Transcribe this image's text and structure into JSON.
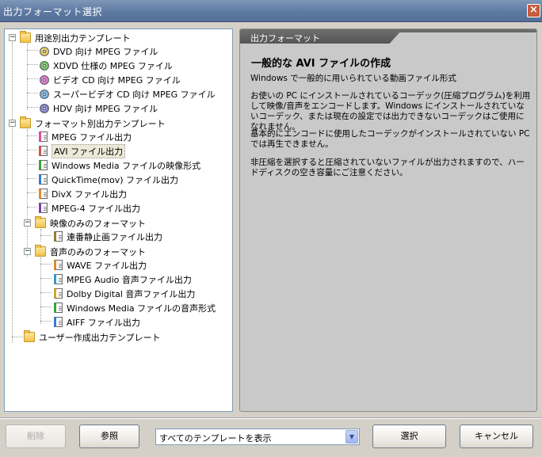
{
  "window": {
    "title": "出力フォーマット選択"
  },
  "tree": {
    "nodes": [
      {
        "label": "用途別出力テンプレート"
      },
      {
        "label": "DVD 向け MPEG ファイル"
      },
      {
        "label": "XDVD 仕様の MPEG ファイル"
      },
      {
        "label": "ビデオ CD 向け MPEG ファイル"
      },
      {
        "label": "スーパービデオ CD 向け MPEG ファイル"
      },
      {
        "label": "HDV 向け MPEG ファイル"
      },
      {
        "label": "フォーマット別出力テンプレート"
      },
      {
        "label": "MPEG ファイル出力"
      },
      {
        "label": "AVI ファイル出力"
      },
      {
        "label": "Windows Media ファイルの映像形式"
      },
      {
        "label": "QuickTime(mov) ファイル出力"
      },
      {
        "label": "DivX ファイル出力"
      },
      {
        "label": "MPEG-4 ファイル出力"
      },
      {
        "label": "映像のみのフォーマット"
      },
      {
        "label": "連番静止画ファイル出力"
      },
      {
        "label": "音声のみのフォーマット"
      },
      {
        "label": "WAVE ファイル出力"
      },
      {
        "label": "MPEG Audio 音声ファイル出力"
      },
      {
        "label": "Dolby Digital 音声ファイル出力"
      },
      {
        "label": "Windows Media ファイルの音声形式"
      },
      {
        "label": "AIFF ファイル出力"
      },
      {
        "label": "ユーザー作成出力テンプレート"
      }
    ],
    "selected": "AVI ファイル出力"
  },
  "info": {
    "header": "出力フォーマット",
    "title": "一般的な AVI ファイルの作成",
    "para1": "Windows で一般的に用いられている動画ファイル形式",
    "para2": "お使いの PC にインストールされているコーデック(圧縮プログラム)を利用して映像/音声をエンコードします。Windows にインストールされていないコーデック、または現在の設定では出力できないコーデックはご使用になれません。",
    "para3": "基本的にエンコードに使用したコーデックがインストールされていない PC では再生できません。",
    "para4": "非圧縮を選択すると圧縮されていないファイルが出力されますので、ハードディスクの空き容量にご注意ください。"
  },
  "footer": {
    "delete_label": "削除",
    "browse_label": "参照",
    "filter_value": "すべてのテンプレートを表示",
    "select_label": "選択",
    "cancel_label": "キャンセル"
  }
}
